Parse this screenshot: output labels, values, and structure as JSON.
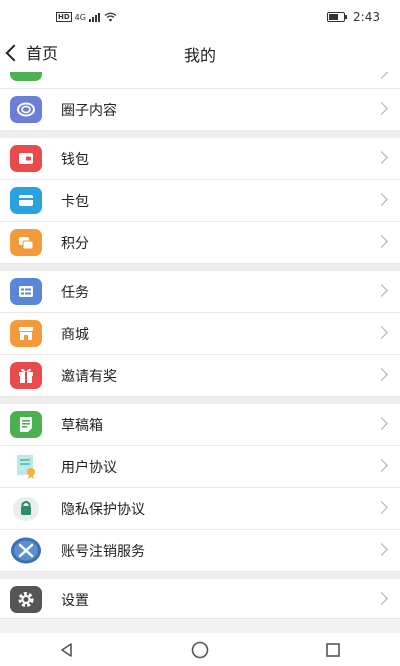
{
  "status_bar": {
    "time": "2:43",
    "network": "4G",
    "hd": "HD"
  },
  "nav": {
    "back_label": "首页",
    "title": "我的"
  },
  "items": [
    {
      "label": "",
      "icon": "partial-icon",
      "color": "#4caf50"
    },
    {
      "label": "圈子内容",
      "icon": "circle-content-icon",
      "color": "#6c7fd8"
    },
    {
      "label": "钱包",
      "icon": "wallet-icon",
      "color": "#e84b4b"
    },
    {
      "label": "卡包",
      "icon": "card-icon",
      "color": "#29a3e0"
    },
    {
      "label": "积分",
      "icon": "points-icon",
      "color": "#f39a3b"
    },
    {
      "label": "任务",
      "icon": "task-icon",
      "color": "#5b86d8"
    },
    {
      "label": "商城",
      "icon": "mall-icon",
      "color": "#f39a3b"
    },
    {
      "label": "邀请有奖",
      "icon": "gift-icon",
      "color": "#e84b4b"
    },
    {
      "label": "草稿箱",
      "icon": "drafts-icon",
      "color": "#4caf50"
    },
    {
      "label": "用户协议",
      "icon": "user-agreement-icon",
      "color": "#5bc8c0"
    },
    {
      "label": "隐私保护协议",
      "icon": "privacy-lock-icon",
      "color": "#2e8b6e"
    },
    {
      "label": "账号注销服务",
      "icon": "account-cancel-icon",
      "color": "#3a6fb0"
    },
    {
      "label": "设置",
      "icon": "gear-icon",
      "color": "#555555"
    }
  ]
}
